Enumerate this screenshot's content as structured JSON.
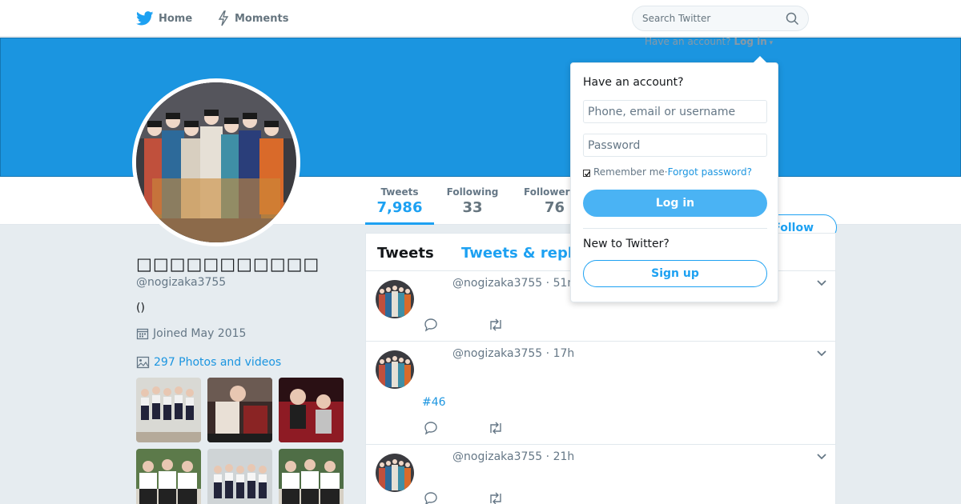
{
  "nav": {
    "home_label": "Home",
    "moments_label": "Moments",
    "search_placeholder": "Search Twitter"
  },
  "login_hint": {
    "prefix": "Have an account?",
    "link": "Log in"
  },
  "profile": {
    "display_name": "□□□□□□□□□□□",
    "screen_name": "@nogizaka3755",
    "bio": "()",
    "joined": "Joined May 2015",
    "photos_link": "297 Photos and videos"
  },
  "stats": [
    {
      "label": "Tweets",
      "value": "7,986"
    },
    {
      "label": "Following",
      "value": "33"
    },
    {
      "label": "Followers",
      "value": "76"
    }
  ],
  "follow_label": "Follow",
  "timeline": {
    "tab_tweets": "Tweets",
    "tab_replies": "Tweets & replies",
    "tweets": [
      {
        "header": "@nogizaka3755 · 51m",
        "text": ""
      },
      {
        "header": "@nogizaka3755 · 17h",
        "text": "#46"
      },
      {
        "header": "@nogizaka3755 · 21h",
        "text": ""
      }
    ]
  },
  "login_dropdown": {
    "title": "Have an account?",
    "username_placeholder": "Phone, email or username",
    "password_placeholder": "Password",
    "remember": "Remember me",
    "separator": " · ",
    "forgot": "Forgot password?",
    "login_button": "Log in",
    "new_label": "New to Twitter?",
    "signup_button": "Sign up"
  },
  "colors": {
    "brand_blue": "#1da1f2",
    "banner": "#1b95e0",
    "background": "#e6ecf0"
  },
  "icons": [
    "twitter-bird-icon",
    "lightning-icon",
    "search-icon",
    "calendar-icon",
    "image-icon",
    "reply-icon",
    "retweet-icon",
    "like-icon",
    "chevron-down-icon"
  ]
}
